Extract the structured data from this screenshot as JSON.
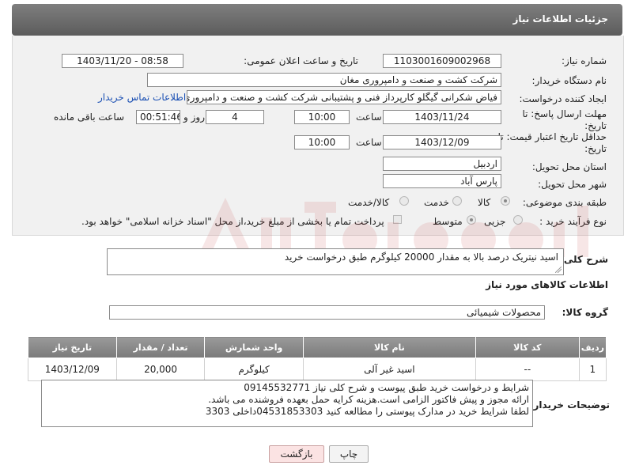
{
  "header": {
    "title": "جزئیات اطلاعات نیاز"
  },
  "fields": {
    "need_number_label": "شماره نیاز:",
    "need_number": "1103001609002968",
    "announce_label": "تاریخ و ساعت اعلان عمومی:",
    "announce_value": "1403/11/20 - 08:58",
    "buyer_label": "نام دستگاه خریدار:",
    "buyer_value": "شرکت کشت و صنعت و دامپروری مغان",
    "creator_label": "ایجاد کننده درخواست:",
    "creator_value": "فیاض شکرانی گیگلو کارپرداز فنی و پشتیبانی شرکت کشت و صنعت و دامپروری",
    "contact_link": "اطلاعات تماس خریدار",
    "deadline_label_1": "مهلت ارسال پاسخ: تا",
    "deadline_label_2": "تاریخ:",
    "deadline_date": "1403/11/24",
    "time_label": "ساعت",
    "deadline_time": "10:00",
    "days_value": "4",
    "days_label": "روز و",
    "remaining_time": "00:51:46",
    "remaining_label": "ساعت باقی مانده",
    "validity_label_1": "حداقل تاریخ اعتبار قیمت: تا",
    "validity_label_2": "تاریخ:",
    "validity_date": "1403/12/09",
    "validity_time": "10:00",
    "province_label": "استان محل تحویل:",
    "province_value": "اردبیل",
    "city_label": "شهر محل تحویل:",
    "city_value": "پارس آباد",
    "category_label": "طبقه بندی موضوعی:",
    "category_options": [
      "کالا",
      "خدمت",
      "کالا/خدمت"
    ],
    "category_selected": "کالا",
    "process_label": "نوع فرآیند خرید :",
    "process_options": [
      "جزیی",
      "متوسط"
    ],
    "process_selected": "جزیی",
    "payment_note": "پرداخت تمام یا بخشی از مبلغ خرید،از محل \"اسناد خزانه اسلامی\" خواهد بود."
  },
  "summary": {
    "label": "شرح کلی نیاز:",
    "value": "اسید نیتریک درصد بالا به مقدار 20000 کیلوگرم طبق درخواست خرید"
  },
  "goods_section": {
    "title": "اطلاعات کالاهای مورد نیاز",
    "group_label": "گروه کالا:",
    "group_value": "محصولات شیمیائی"
  },
  "table": {
    "headers": [
      "ردیف",
      "کد کالا",
      "نام کالا",
      "واحد شمارش",
      "تعداد / مقدار",
      "تاریخ نیاز"
    ],
    "rows": [
      [
        "1",
        "--",
        "اسید غیر آلی",
        "کیلوگرم",
        "20,000",
        "1403/12/09"
      ]
    ]
  },
  "buyer_notes": {
    "label": "توضیحات خریدار:",
    "lines": [
      "شرایط و درخواست خرید طبق پیوست و شرح کلی نیاز 09145532771",
      "ارائه مجوز و پیش فاکتور الزامی است.هزینه کرایه حمل بعهده فروشنده می باشد.",
      "لطفا شرایط خرید در مدارک پیوستی را مطالعه کنید 04531853303داخلی 3303"
    ]
  },
  "buttons": {
    "print": "چاپ",
    "back": "بازگشت"
  },
  "colors": {
    "header_bg": "#6b6b6b",
    "panel_bg": "#f1f1f1",
    "link": "#1a4fb3",
    "back_bg": "#fbe3e3"
  }
}
